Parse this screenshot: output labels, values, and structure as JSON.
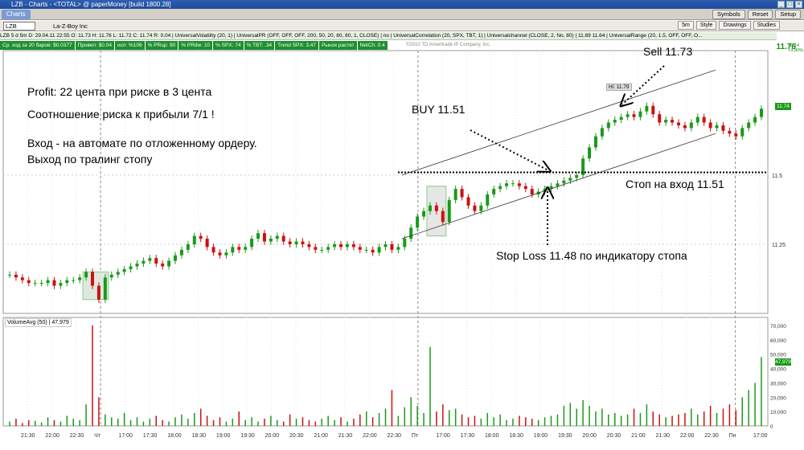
{
  "window": {
    "title": "LZB - Charts - <TOTAL> @ paperMoney [build 1800.28]"
  },
  "toolbar": {
    "tab": "Charts",
    "buttons": [
      "Symbols",
      "Reset",
      "Setup"
    ]
  },
  "symbolbar": {
    "symbol": "LZB",
    "company": "La-Z-Boy Inc",
    "quote": "LZB 5 d 5m   D: 29.04.11 22:55   O: 11.73   H: 11.76   L: 11.72   C: 11.74   R: 0.04",
    "buttons": [
      "5m",
      "Style",
      "Drawings",
      "Studies"
    ],
    "last_price": "11.76",
    "change": "+0.14",
    "change_pct": "+3.80%"
  },
  "studies": "UniversalVolatility (20, 1) | UniversalPR (OFF, OFF, OFF, 200, 50, 20, 80, 80, 1, CLOSE) | no | UniversalCorrelation (20, SPX, TBT, 1) | Universalchannel (CLOSE, 2, No, 80) | 11.89  11.64 | UniversalRange (20, 1.5, OFF, OFF, O...",
  "stats": [
    "Ср. ход за 20 баров: $0.0377",
    "Провел: $0.04",
    "исп: %106",
    "% PRup: 90",
    "% PRdw: 10",
    "% SPX: 74",
    "% TBT: .34",
    "Trend SPX: 3.47",
    "Рынок растет",
    "NetCh: 0.4"
  ],
  "copyright": "©2010 TD Ameritrade IP Company, Inc.",
  "annotations": {
    "profit": "Profit: 22 цента при риске в 3 цента",
    "ratio": "Соотношение риска к прибыли 7/1 !",
    "entry": "Вход - на автомате по отложенному ордеру.",
    "exit": "Выход по тралинг стопу",
    "buy": "BUY 11.51",
    "sell": "Sell 11.73",
    "stop_entry": "Стоп на вход 11.51",
    "stop_loss": "Stop Loss 11.48 по индикатору стопа",
    "high_marker": "Hi: 11.79"
  },
  "volume_study": {
    "label": "VolumeAvg (50)",
    "value": "47,979",
    "last_tag": "47,979"
  },
  "chart_data": {
    "type": "candlestick",
    "price_axis": {
      "min": 11.0,
      "max": 11.95,
      "ticks": [
        "11.5",
        "11.25"
      ],
      "last_tag": "11.74"
    },
    "volume_axis": {
      "min": 0,
      "max": 70000,
      "ticks": [
        "70,000",
        "60,000",
        "50,000",
        "40,000",
        "30,000",
        "20,000",
        "10,000",
        "0"
      ]
    },
    "time_labels": [
      "21:30",
      "22:00",
      "22:30",
      "Чт",
      "17:00",
      "17:30",
      "18:00",
      "18:30",
      "19:00",
      "19:30",
      "20:00",
      "20:30",
      "21:00",
      "21:30",
      "22:00",
      "22:30",
      "Пт",
      "17:00",
      "17:30",
      "18:00",
      "18:30",
      "19:00",
      "19:30",
      "20:00",
      "20:30",
      "21:00",
      "21:30",
      "22:00",
      "22:30",
      "Пн",
      "17:00"
    ],
    "levels": {
      "entry": 11.51,
      "stop_loss": 11.48,
      "sell": 11.73,
      "high": 11.79
    },
    "closes": [
      11.14,
      11.13,
      11.12,
      11.11,
      11.11,
      11.11,
      11.12,
      11.1,
      11.11,
      11.12,
      11.12,
      11.13,
      11.15,
      11.1,
      11.05,
      11.13,
      11.14,
      11.15,
      11.16,
      11.17,
      11.18,
      11.19,
      11.2,
      11.18,
      11.17,
      11.19,
      11.21,
      11.23,
      11.25,
      11.28,
      11.27,
      11.24,
      11.22,
      11.21,
      11.22,
      11.24,
      11.23,
      11.24,
      11.27,
      11.29,
      11.26,
      11.27,
      11.28,
      11.26,
      11.25,
      11.26,
      11.25,
      11.24,
      11.23,
      11.23,
      11.24,
      11.25,
      11.24,
      11.25,
      11.24,
      11.23,
      11.23,
      11.22,
      11.24,
      11.25,
      11.23,
      11.24,
      11.27,
      11.31,
      11.35,
      11.37,
      11.39,
      11.37,
      11.33,
      11.41,
      11.45,
      11.42,
      11.39,
      11.37,
      11.39,
      11.43,
      11.45,
      11.46,
      11.47,
      11.47,
      11.46,
      11.45,
      11.43,
      11.44,
      11.45,
      11.46,
      11.47,
      11.48,
      11.49,
      11.5,
      11.56,
      11.6,
      11.64,
      11.67,
      11.69,
      11.7,
      11.71,
      11.72,
      11.71,
      11.73,
      11.75,
      11.72,
      11.69,
      11.7,
      11.69,
      11.68,
      11.67,
      11.69,
      11.71,
      11.69,
      11.67,
      11.68,
      11.66,
      11.65,
      11.64,
      11.67,
      11.69,
      11.71,
      11.74
    ],
    "volumes": [
      3000,
      5000,
      2000,
      4000,
      3500,
      2500,
      6000,
      4000,
      3000,
      7000,
      5000,
      4000,
      15000,
      70000,
      20000,
      8000,
      6000,
      5000,
      9000,
      4000,
      6000,
      3000,
      5000,
      7000,
      4000,
      3000,
      6000,
      8000,
      5000,
      9000,
      12000,
      7000,
      4000,
      6000,
      3000,
      5000,
      10000,
      4000,
      6000,
      3000,
      5000,
      7000,
      4000,
      3000,
      8000,
      5000,
      6000,
      4000,
      3000,
      5000,
      7000,
      4000,
      6000,
      3000,
      5000,
      8000,
      10000,
      6000,
      9000,
      12000,
      25000,
      7000,
      13000,
      20000,
      14000,
      9000,
      55000,
      10000,
      15000,
      11000,
      12000,
      8000,
      6000,
      7000,
      5000,
      9000,
      6000,
      8000,
      4000,
      5000,
      7000,
      6000,
      5000,
      4000,
      6000,
      7000,
      8000,
      14000,
      16000,
      12000,
      18000,
      14000,
      10000,
      12000,
      8000,
      9000,
      7000,
      8000,
      12000,
      9000,
      15000,
      10000,
      8000,
      6000,
      7000,
      8000,
      9000,
      12000,
      8000,
      10000,
      14000,
      9000,
      12000,
      15000,
      11000,
      20000,
      25000,
      30000,
      47979
    ]
  }
}
